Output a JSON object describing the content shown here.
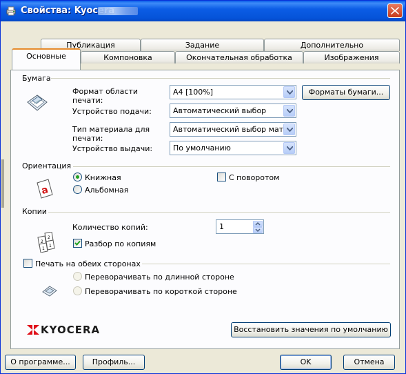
{
  "window": {
    "title": "Свойства: Kyocera",
    "colors": {
      "titlebar": "#0553d8",
      "face": "#ece9d8",
      "panel": "#fcfcfe",
      "close": "#c5391b",
      "tab_active_accent": "#e68b2c"
    }
  },
  "tabs": {
    "row1": [
      "Публикация",
      "Задание",
      "Дополнительно"
    ],
    "row2": [
      "Основные",
      "Компоновка",
      "Окончательная обработка",
      "Изображения"
    ],
    "active": "Основные"
  },
  "paper": {
    "section": "Бумага",
    "format_label": "Формат области печати:",
    "format_value": "A4  [100%]",
    "formats_button": "Форматы бумаги...",
    "source_label": "Устройство подачи:",
    "source_value": "Автоматический выбор",
    "media_label": "Тип материала для печати:",
    "media_value": "Автоматический выбор мат",
    "output_label": "Устройство выдачи:",
    "output_value": "По умолчанию"
  },
  "orientation": {
    "section": "Ориентация",
    "portrait": "Книжная",
    "landscape": "Альбомная",
    "rotated": "С поворотом",
    "selected": "portrait"
  },
  "copies": {
    "section": "Копии",
    "count_label": "Количество копий:",
    "count_value": "1",
    "collate": "Разбор по копиям",
    "collate_checked": true
  },
  "duplex": {
    "label": "Печать на обеих сторонах",
    "checked": false,
    "long_edge": "Переворачивать по длинной стороне",
    "short_edge": "Переворачивать по короткой стороне"
  },
  "brand": {
    "logo_text": "KYOCERA",
    "logo_color": "#e0101a"
  },
  "buttons": {
    "restore": "Восстановить значения по умолчанию",
    "about": "О программе...",
    "profile": "Профиль...",
    "ok": "OK",
    "cancel": "Отмена"
  },
  "icons": [
    "printer-icon",
    "close-icon",
    "paper-icon",
    "portrait-icon",
    "collate-icon",
    "duplex-icon",
    "kyocera-logo-icon",
    "chevron-down-icon"
  ]
}
